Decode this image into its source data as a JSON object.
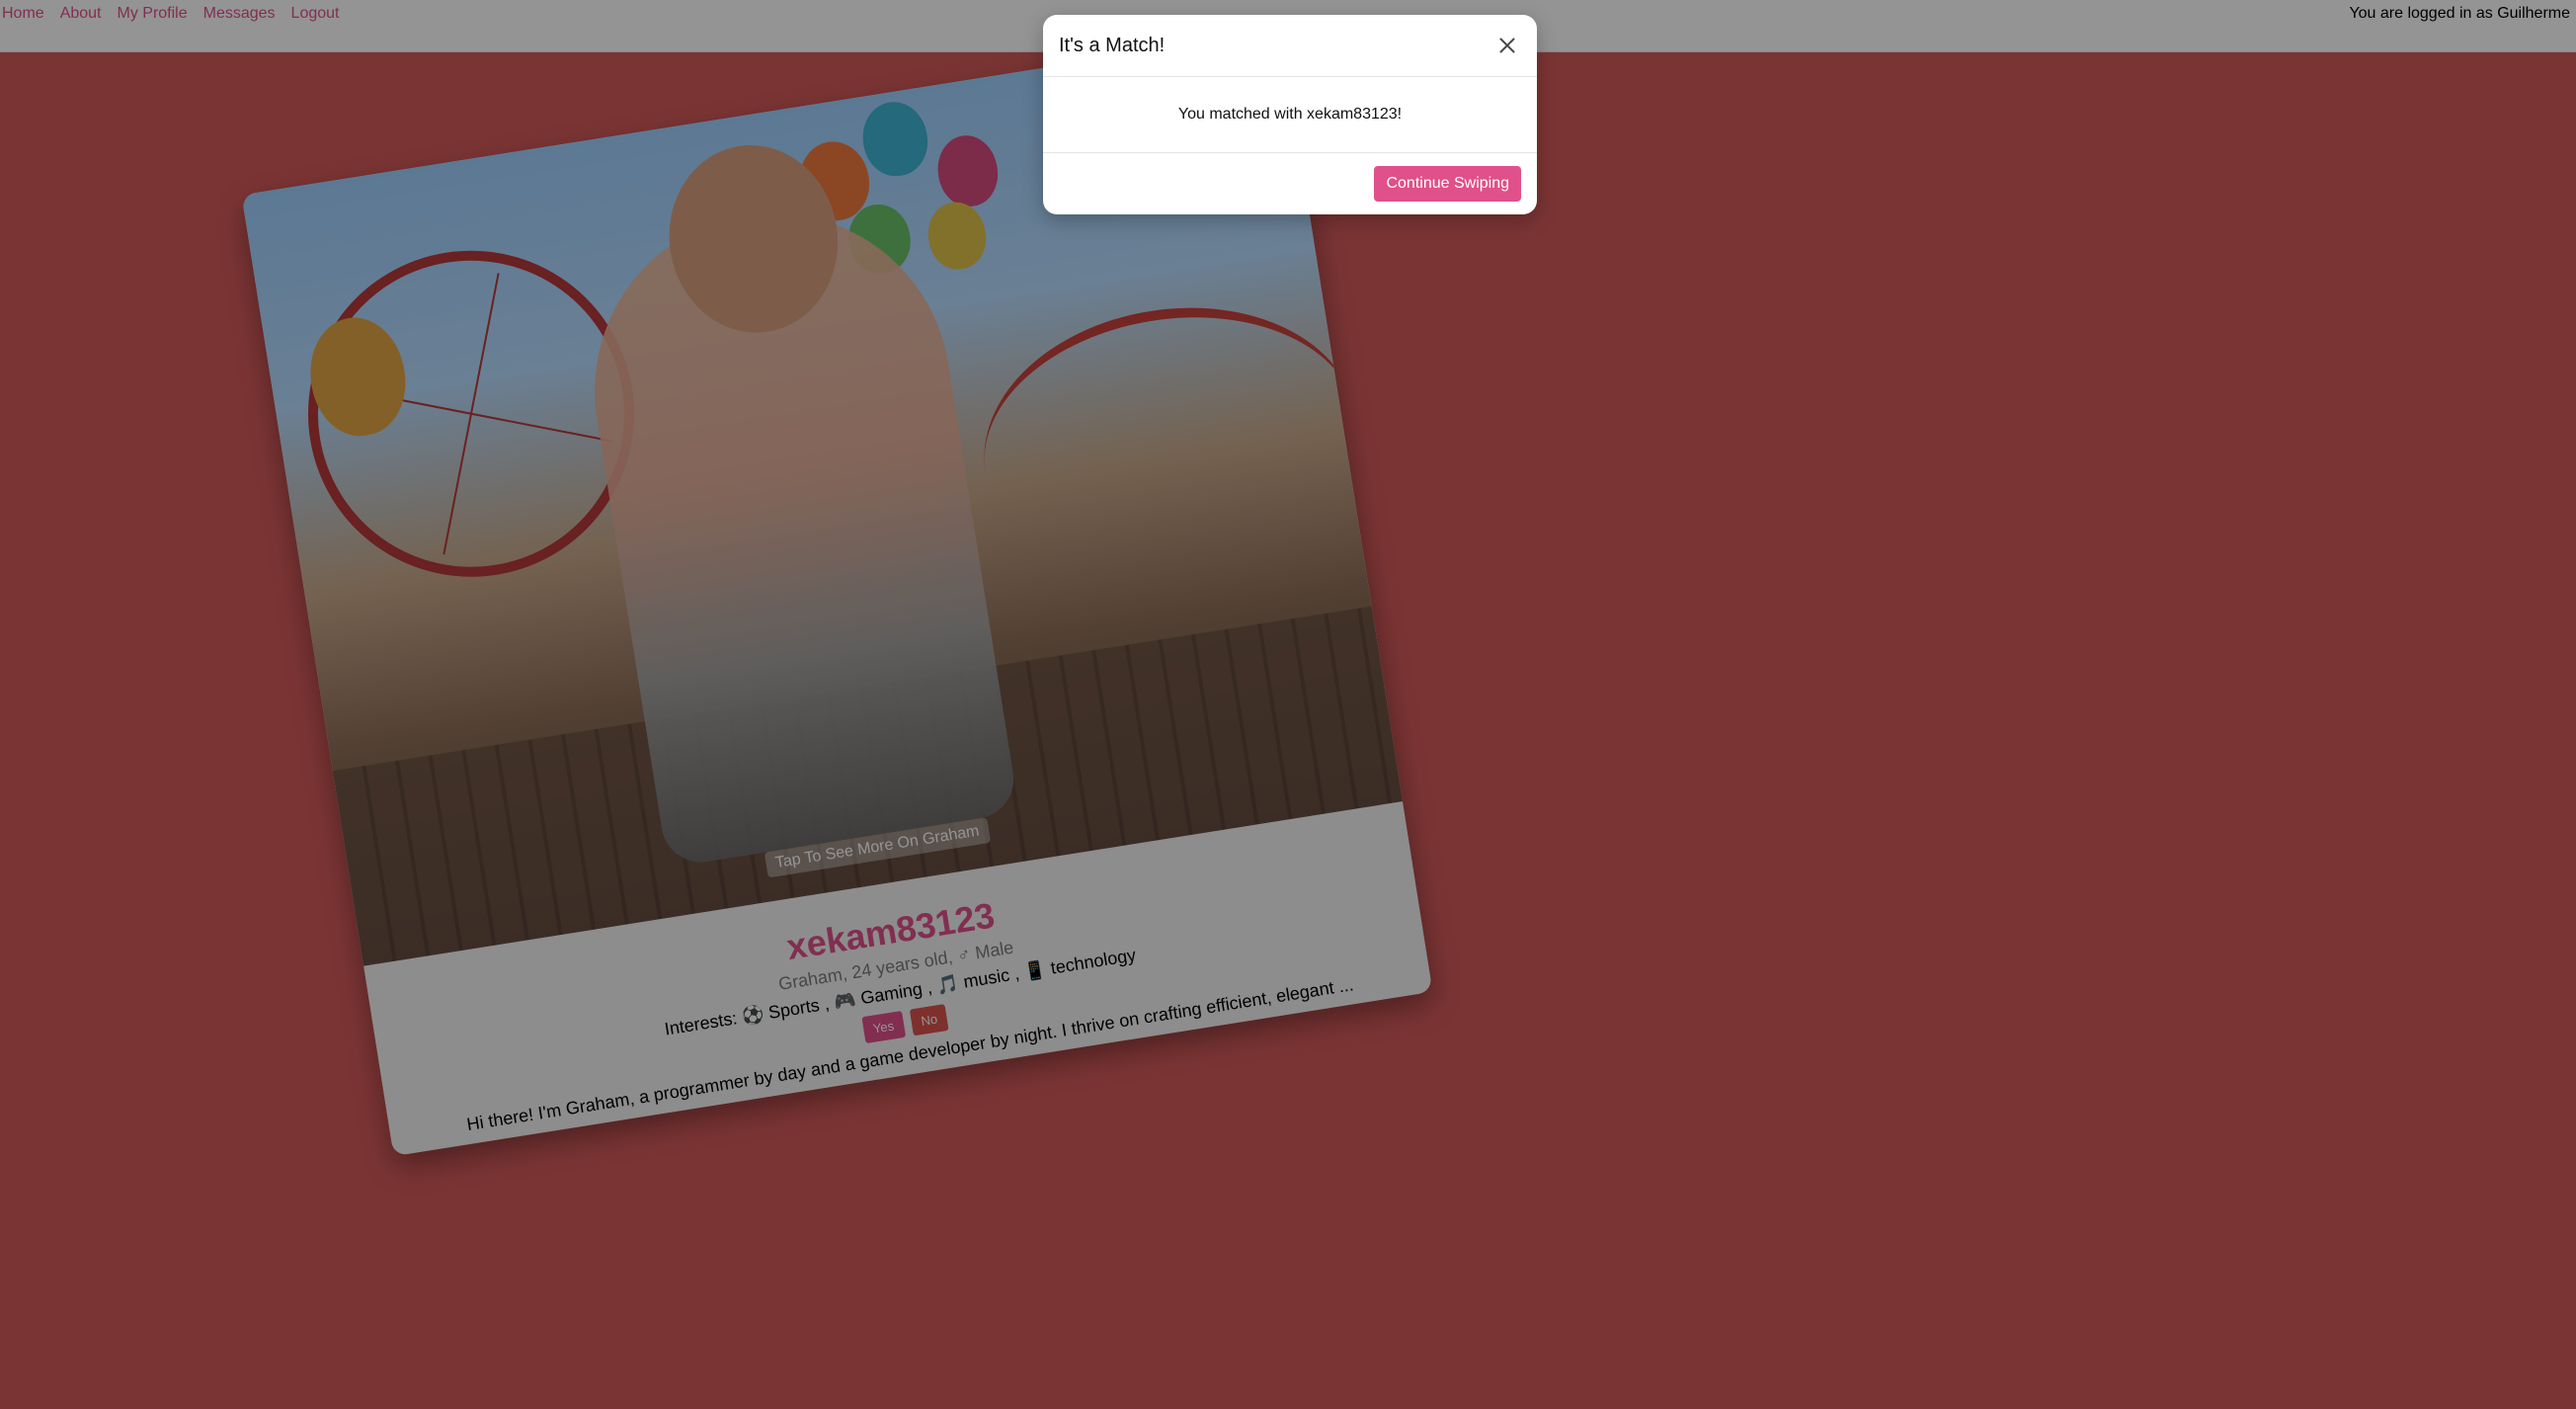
{
  "nav": {
    "items": [
      "Home",
      "About",
      "My Profile",
      "Messages",
      "Logout"
    ],
    "login_status": "You are logged in as Guilherme"
  },
  "card": {
    "tap_hint": "Tap To See More On Graham",
    "username": "xekam83123",
    "subline": "Graham, 24 years old, ♂ Male",
    "interests": "Interests: ⚽ Sports , 🎮 Gaming , 🎵 music , 📱 technology",
    "yes_label": "Yes",
    "no_label": "No",
    "bio": "Hi there! I'm Graham, a programmer by day and a game developer by night. I thrive on crafting efficient, elegant ..."
  },
  "modal": {
    "title": "It's a Match!",
    "message": "You matched with xekam83123!",
    "continue_label": "Continue Swiping"
  },
  "colors": {
    "accent": "#e0508a",
    "background": "#d45a5a",
    "no_button": "#d9534f"
  }
}
